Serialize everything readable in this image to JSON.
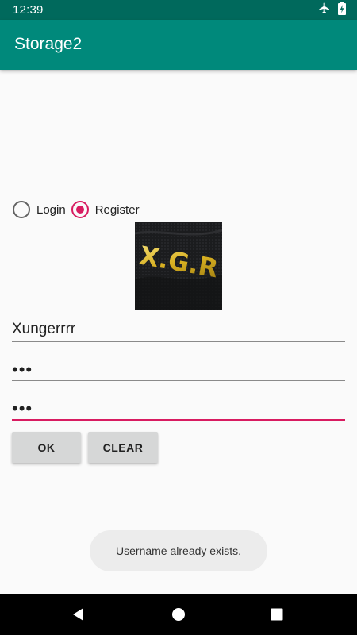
{
  "status_bar": {
    "time": "12:39",
    "icons": [
      "airplane-mode-icon",
      "battery-charging-icon"
    ]
  },
  "app_bar": {
    "title": "Storage2",
    "color": "#00897b",
    "status_color": "#00695c"
  },
  "mode": {
    "options": [
      {
        "label": "Login",
        "selected": false
      },
      {
        "label": "Register",
        "selected": true
      }
    ],
    "accent_color": "#d81b60"
  },
  "photo": {
    "text": "X.G.R"
  },
  "form": {
    "username": "Xungerrrr",
    "password": "•••",
    "confirm_password": "•••"
  },
  "buttons": {
    "ok": "OK",
    "clear": "CLEAR"
  },
  "toast": {
    "message": "Username already exists."
  },
  "nav_bar": {
    "icons": [
      "back-icon",
      "home-icon",
      "recents-icon"
    ]
  }
}
